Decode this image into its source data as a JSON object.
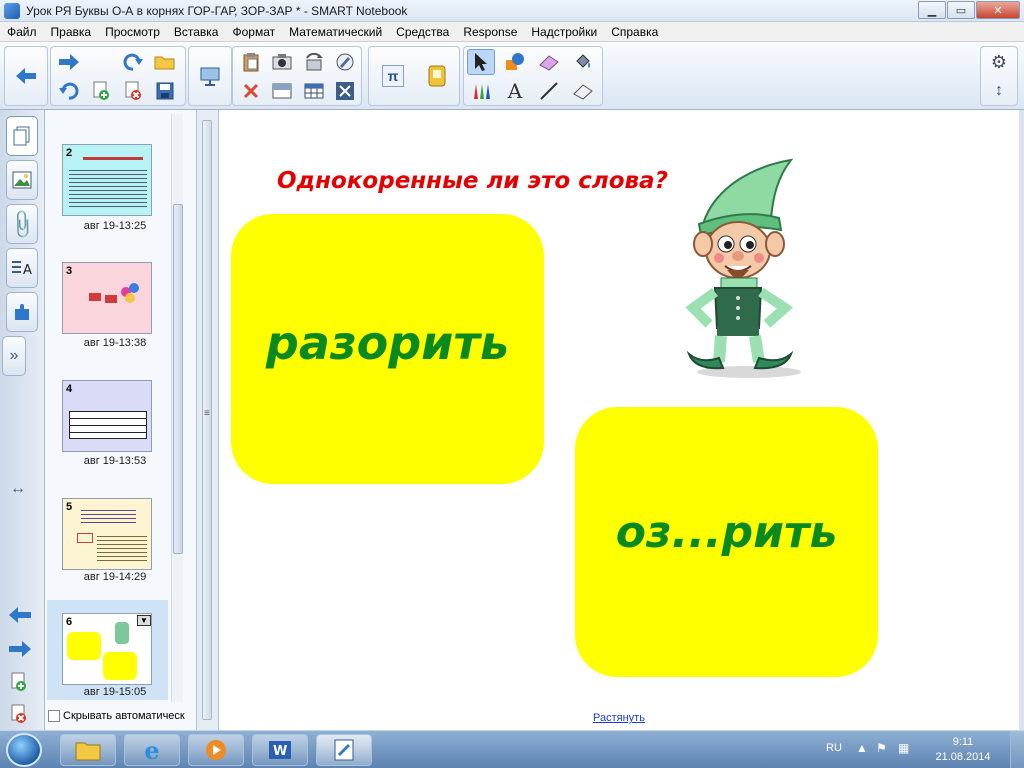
{
  "window": {
    "title": "Урок РЯ Буквы О-А в корнях ГОР-ГАР, ЗОР-ЗАР * - SMART Notebook",
    "minimize": "▁",
    "maximize": "▭",
    "close": "✕"
  },
  "menu": [
    "Файл",
    "Правка",
    "Просмотр",
    "Вставка",
    "Формат",
    "Математический",
    "Средства",
    "Response",
    "Надстройки",
    "Справка"
  ],
  "toolbar": {
    "icons": {
      "back": "arrow-left-icon",
      "forward": "arrow-right-icon",
      "undo": "undo-icon",
      "redo": "redo-icon",
      "add_page": "add-page-icon",
      "delete_page": "delete-page-icon",
      "open": "open-folder-icon",
      "save": "save-icon",
      "projector": "projector-icon",
      "paste": "paste-icon",
      "delete": "delete-x-icon",
      "screenshade": "screen-shade-icon",
      "table": "table-icon",
      "capture": "camera-icon",
      "fullscreen": "fullscreen-icon",
      "math": "pi-icon",
      "response": "response-icon",
      "select": "select-arrow-icon",
      "shapes": "shapes-icon",
      "eraser": "eraser-icon",
      "fill": "fill-bucket-icon",
      "pens": "pens-icon",
      "text": "text-a-icon",
      "line": "line-icon",
      "magic_eraser": "eraser-block-icon",
      "settings": "gear-icon",
      "move_toolbar": "updown-arrows-icon"
    },
    "math_glyph": "π",
    "text_glyph": "A"
  },
  "sidetabs": [
    "page-sorter-icon",
    "gallery-icon",
    "attachments-icon",
    "properties-icon",
    "addons-icon"
  ],
  "sidebar_controls": {
    "expand": "»",
    "resize": "↔",
    "prev_page": "arrow-left-icon",
    "next_page": "arrow-right-icon",
    "add_page": "add-page-icon",
    "delete_page": "delete-page-icon"
  },
  "pages": [
    {
      "num": "2",
      "time": "авг 19-13:25"
    },
    {
      "num": "3",
      "time": "авг 19-13:38"
    },
    {
      "num": "4",
      "time": "авг 19-13:53"
    },
    {
      "num": "5",
      "time": "авг 19-14:29"
    },
    {
      "num": "6",
      "time": "авг 19-15:05",
      "selected": true
    }
  ],
  "autohide_label": "Скрывать автоматическ",
  "slide": {
    "question": "Однокоренные ли это слова?",
    "word1": "разорить",
    "word2": "оз...рить",
    "stretch_link": "Растянуть"
  },
  "colors": {
    "card": "#ffff00",
    "word": "#0a8a1e",
    "question": "#e40000"
  },
  "taskbar": {
    "apps": [
      "explorer-icon",
      "internet-explorer-icon",
      "media-player-icon",
      "word-icon",
      "smart-notebook-icon"
    ],
    "lang": "RU",
    "time": "9:11",
    "date": "21.08.2014"
  }
}
